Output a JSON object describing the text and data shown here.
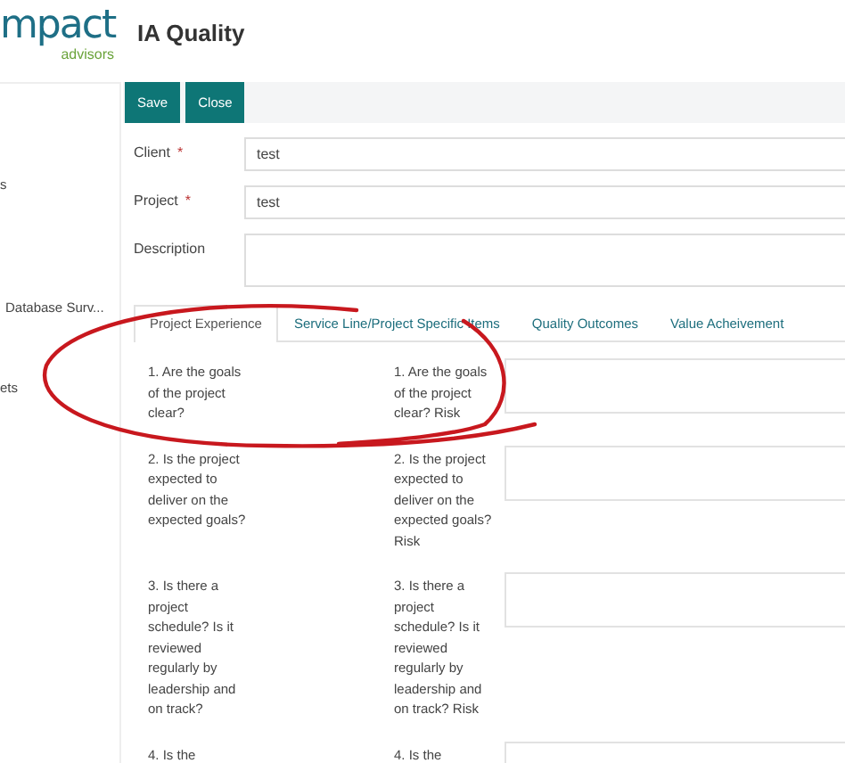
{
  "header": {
    "logo": {
      "main": "mpact",
      "sub": "advisors"
    },
    "title": "IA Quality"
  },
  "sidebar": {
    "items": [
      {
        "label": "s"
      },
      {
        "label": "Database Surv..."
      },
      {
        "label": "ets"
      }
    ]
  },
  "toolbar": {
    "buttons": [
      "Save",
      "Close"
    ]
  },
  "form": {
    "fields": [
      {
        "label": "Client",
        "required_mark": "*",
        "value": "test",
        "kind": "input"
      },
      {
        "label": "Project",
        "required_mark": "*",
        "value": "test",
        "kind": "input"
      },
      {
        "label": "Description",
        "kind": "textarea"
      }
    ]
  },
  "tabs": [
    {
      "label": "Project Experience",
      "selected": true
    },
    {
      "label": "Service Line/Project Specific Items",
      "selected": false
    },
    {
      "label": "Quality Outcomes",
      "selected": false
    },
    {
      "label": "Value Acheivement",
      "selected": false
    }
  ],
  "questions": [
    {
      "question": "1. Are the goals of the project clear?",
      "risk": "1. Are the goals of the project clear? Risk"
    },
    {
      "question": "2. Is the project expected to deliver on the expected goals?",
      "risk": "2. Is the project expected to deliver on the expected goals? Risk"
    },
    {
      "question": "3. Is there a project schedule? Is it reviewed regularly by leadership and on track?",
      "risk": "3. Is there a project schedule? Is it reviewed regularly by leadership and on track? Risk"
    },
    {
      "question": "4. Is the",
      "risk": "4. Is the"
    }
  ]
}
